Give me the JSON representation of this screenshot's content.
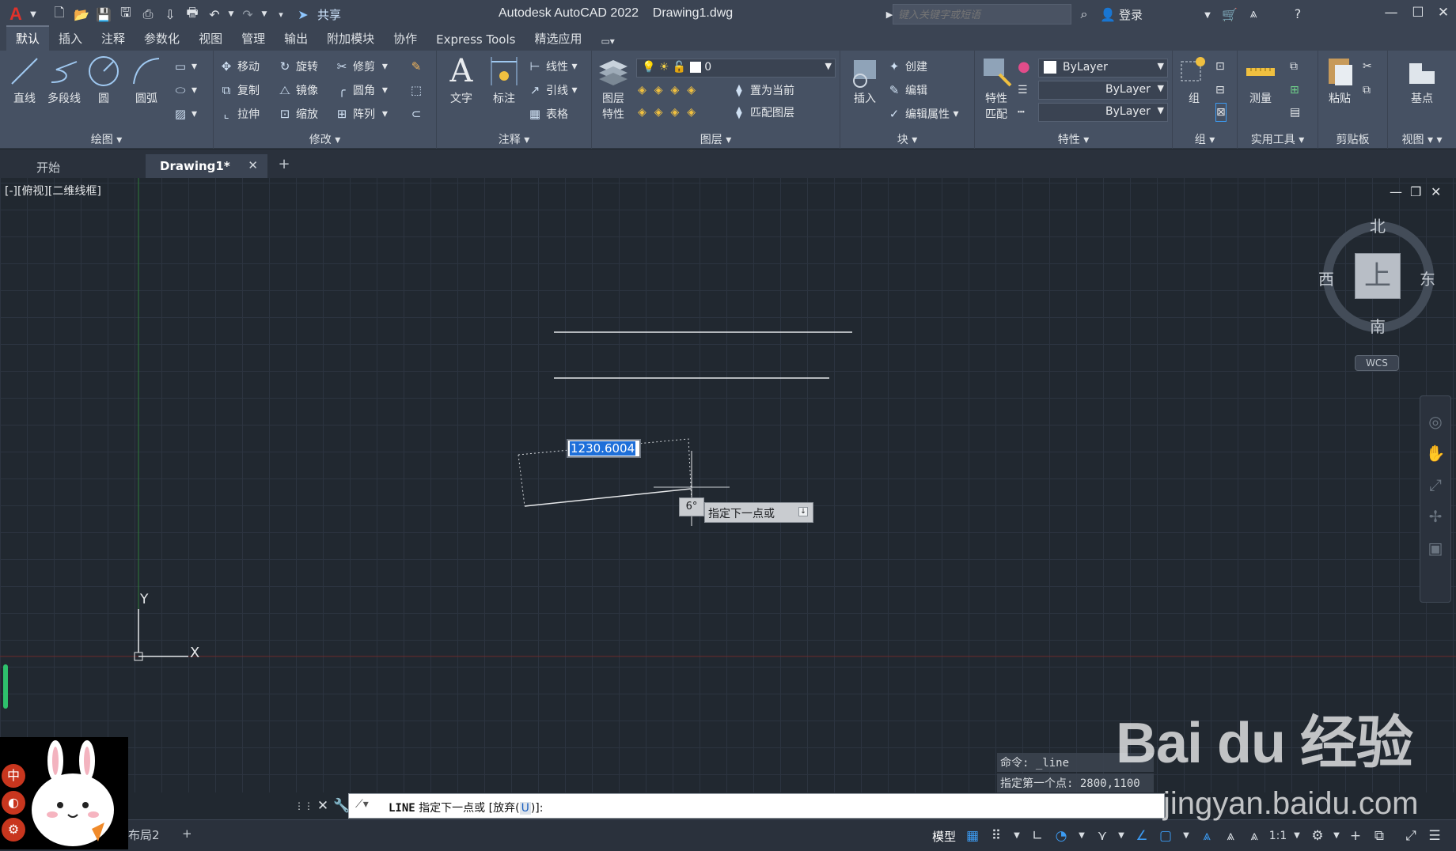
{
  "titlebar": {
    "app_title": "Autodesk AutoCAD 2022    Drawing1.dwg",
    "share_label": "共享",
    "search_placeholder": "键入关键字或短语",
    "login_label": "登录"
  },
  "ribbon_tabs": [
    "默认",
    "插入",
    "注释",
    "参数化",
    "视图",
    "管理",
    "输出",
    "附加模块",
    "协作",
    "Express Tools",
    "精选应用"
  ],
  "ribbon": {
    "draw": {
      "panel_label": "绘图",
      "line": "直线",
      "polyline": "多段线",
      "circle": "圆",
      "arc": "圆弧"
    },
    "modify": {
      "panel_label": "修改",
      "move": "移动",
      "rotate": "旋转",
      "trim": "修剪",
      "copy": "复制",
      "mirror": "镜像",
      "fillet": "圆角",
      "stretch": "拉伸",
      "scale": "缩放",
      "array": "阵列"
    },
    "annotation": {
      "panel_label": "注释",
      "text": "文字",
      "dimension": "标注",
      "linear": "线性",
      "leader": "引线",
      "table": "表格"
    },
    "layers": {
      "panel_label": "图层",
      "layer_properties": "图层\n特性",
      "layer_props_line1": "图层",
      "layer_props_line2": "特性",
      "current_layer": "0",
      "set_current": "置为当前",
      "match_layer": "匹配图层"
    },
    "block": {
      "panel_label": "块",
      "insert": "插入",
      "create": "创建",
      "edit": "编辑",
      "edit_attributes": "编辑属性"
    },
    "properties": {
      "panel_label": "特性",
      "match_line1": "特性",
      "match_line2": "匹配",
      "color": "ByLayer",
      "linetype": "ByLayer",
      "lineweight": "ByLayer"
    },
    "groups": {
      "panel_label": "组",
      "group": "组"
    },
    "utilities": {
      "panel_label": "实用工具",
      "measure": "测量"
    },
    "clipboard": {
      "panel_label": "剪贴板",
      "paste": "粘贴"
    },
    "view": {
      "panel_label": "视图",
      "base": "基点"
    }
  },
  "doc_tabs": {
    "start": "开始",
    "active": "Drawing1*"
  },
  "viewport": {
    "label": "[-][俯视][二维线框]",
    "dynamic_input_value": "1230.6004",
    "angle": "6°",
    "prompt": "指定下一点或",
    "compass": {
      "north": "北",
      "south": "南",
      "east": "东",
      "west": "西",
      "top": "上"
    },
    "wcs": "WCS",
    "ucs_x": "X",
    "ucs_y": "Y"
  },
  "command": {
    "history": [
      "命令: _line",
      "指定第一个点: 2800,1100"
    ],
    "keyword": "LINE",
    "prompt_text": "指定下一点或",
    "option_open": "[放弃(",
    "option_key": "U",
    "option_close": ")]:"
  },
  "statusbar": {
    "layout2": "布局2",
    "model": "模型",
    "scale": "1:1"
  },
  "ime": {
    "chinese": "中"
  },
  "watermark": {
    "main": "Bai du 经验",
    "sub": "jingyan.baidu.com"
  },
  "colors": {
    "canvas": "#212830",
    "ribbon": "#465163",
    "accent": "#1e6fd9",
    "status_on": "#3c9bf2"
  }
}
